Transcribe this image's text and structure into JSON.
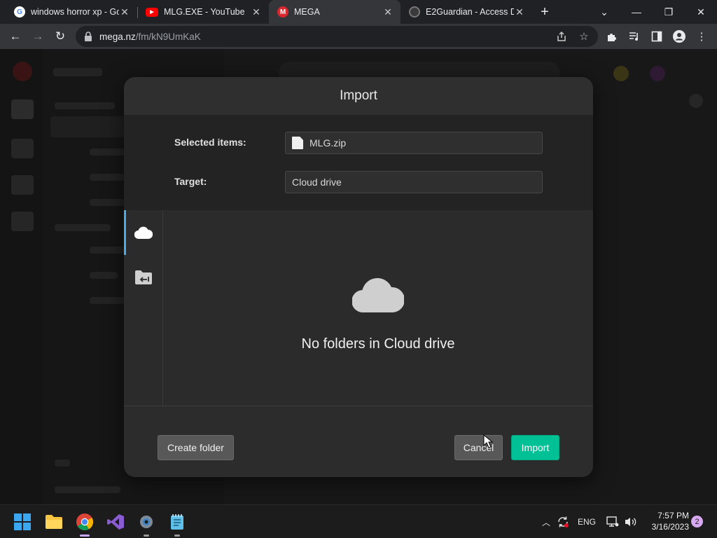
{
  "tabs": [
    {
      "title": "windows horror xp - Go",
      "favicon": "google-icon",
      "active": false
    },
    {
      "title": "MLG.EXE - YouTube",
      "favicon": "youtube-icon",
      "active": false
    },
    {
      "title": "MEGA",
      "favicon": "mega-icon",
      "active": true
    },
    {
      "title": "E2Guardian - Access De",
      "favicon": "e2guardian-icon",
      "active": false
    }
  ],
  "address": {
    "host": "mega.nz",
    "path": "/fm/kN9UmKaK"
  },
  "modal": {
    "title": "Import",
    "selected_label": "Selected items:",
    "selected_value": "MLG.zip",
    "target_label": "Target:",
    "target_value": "Cloud drive",
    "empty_message": "No folders in Cloud drive",
    "create_folder": "Create folder",
    "cancel": "Cancel",
    "import": "Import"
  },
  "taskbar": {
    "language": "ENG",
    "time": "7:57 PM",
    "date": "3/16/2023",
    "notification_count": "2"
  },
  "colors": {
    "accent_green": "#00c095",
    "active_tab_indicator": "#4aa9ea",
    "mega_red": "#d9272e"
  }
}
